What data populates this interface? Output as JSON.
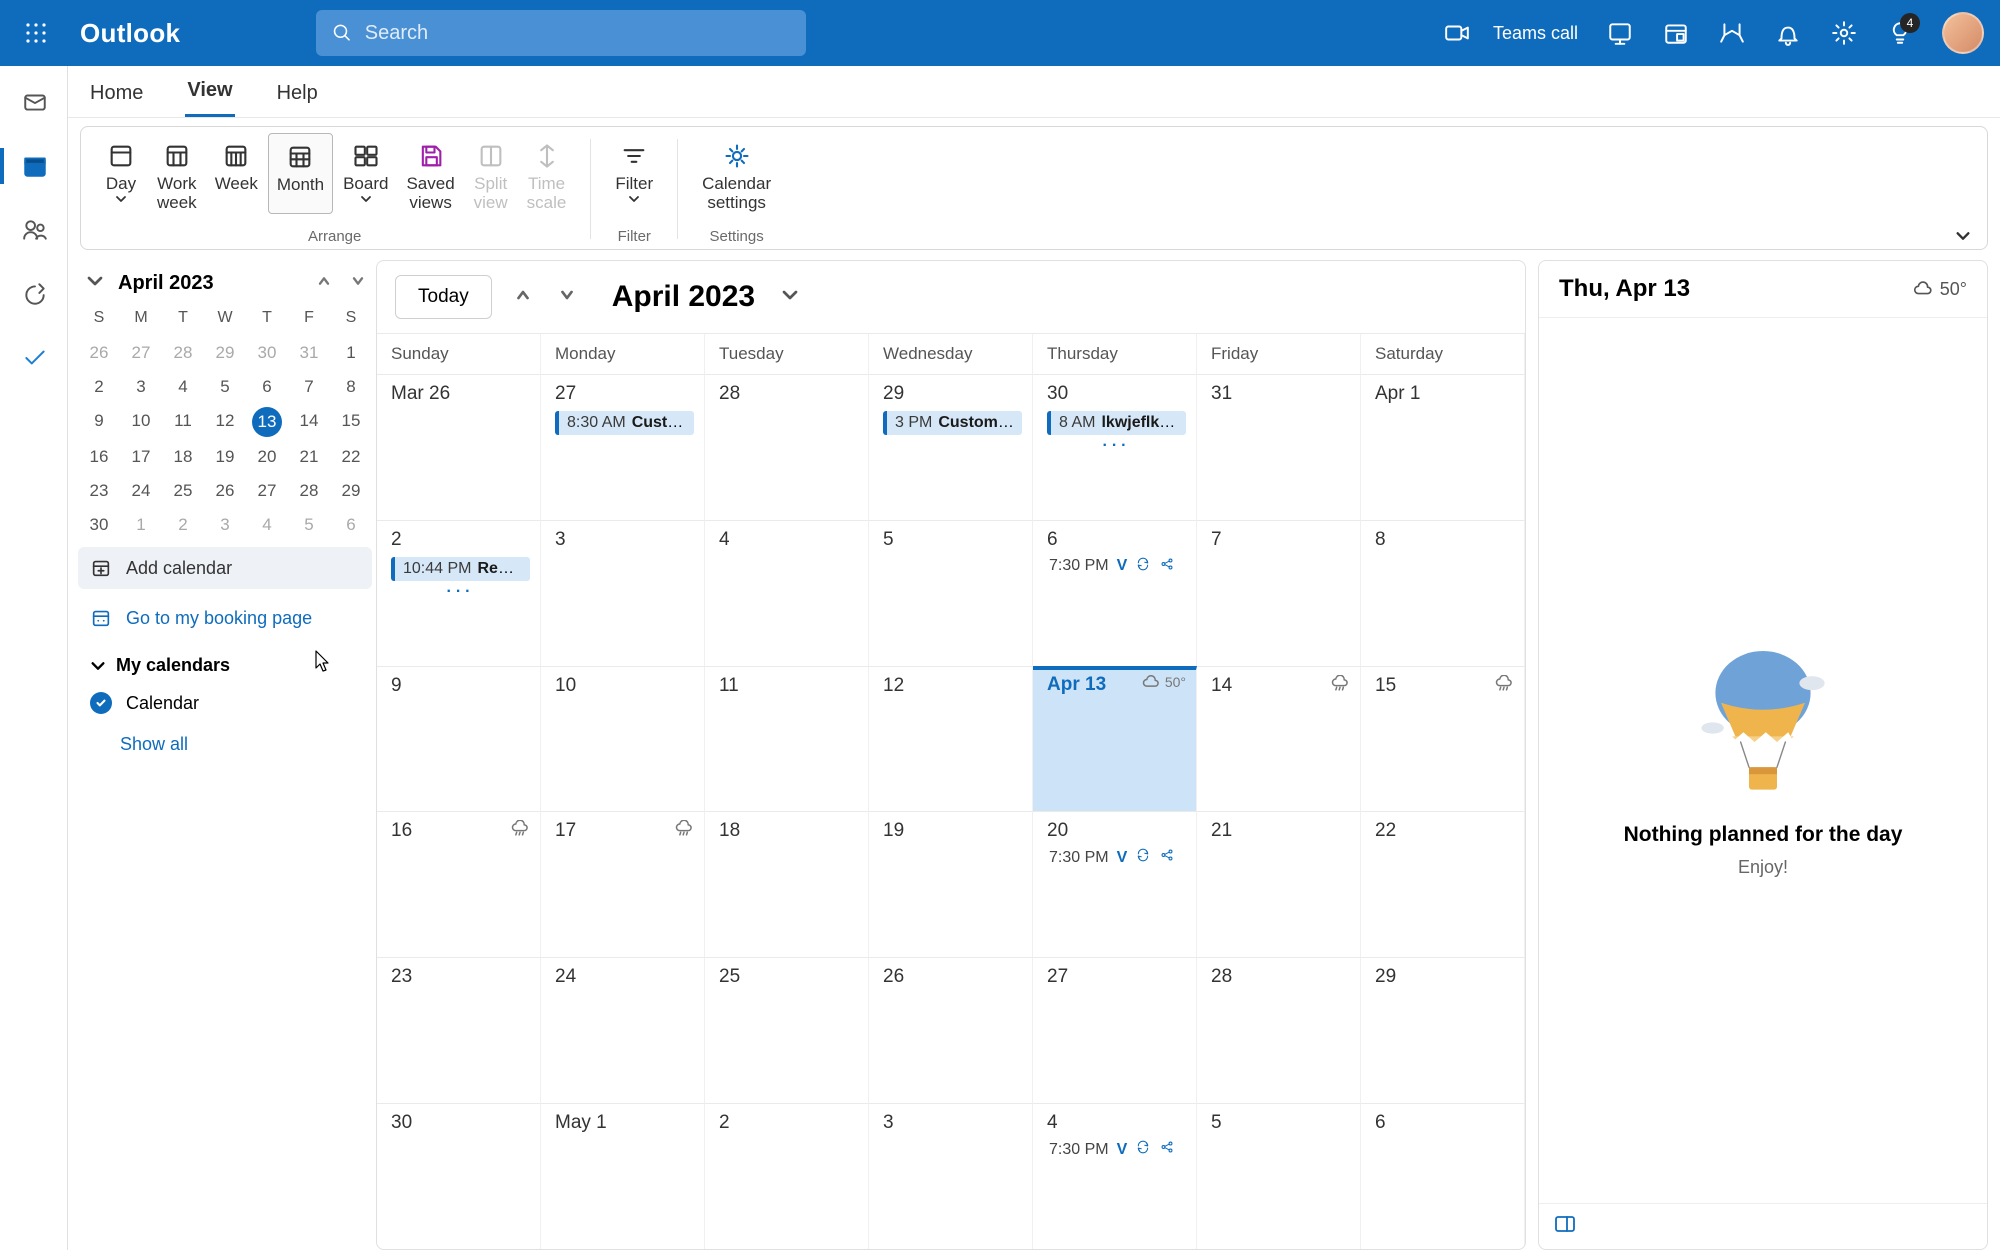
{
  "topbar": {
    "brand": "Outlook",
    "search_placeholder": "Search",
    "teams_label": "Teams call",
    "tips_badge": "4"
  },
  "tabs": {
    "home": "Home",
    "view": "View",
    "help": "Help"
  },
  "ribbon": {
    "day": "Day",
    "workweek": "Work\nweek",
    "week": "Week",
    "month": "Month",
    "board": "Board",
    "saved": "Saved\nviews",
    "split": "Split\nview",
    "timescale": "Time\nscale",
    "filter": "Filter",
    "calsettings": "Calendar\nsettings",
    "group_arrange": "Arrange",
    "group_filter": "Filter",
    "group_settings": "Settings"
  },
  "mini": {
    "title": "April 2023",
    "dow": [
      "S",
      "M",
      "T",
      "W",
      "T",
      "F",
      "S"
    ],
    "cells": [
      {
        "n": "26",
        "o": true
      },
      {
        "n": "27",
        "o": true
      },
      {
        "n": "28",
        "o": true
      },
      {
        "n": "29",
        "o": true
      },
      {
        "n": "30",
        "o": true
      },
      {
        "n": "31",
        "o": true
      },
      {
        "n": "1"
      },
      {
        "n": "2"
      },
      {
        "n": "3"
      },
      {
        "n": "4"
      },
      {
        "n": "5"
      },
      {
        "n": "6"
      },
      {
        "n": "7"
      },
      {
        "n": "8"
      },
      {
        "n": "9"
      },
      {
        "n": "10"
      },
      {
        "n": "11"
      },
      {
        "n": "12"
      },
      {
        "n": "13",
        "today": true
      },
      {
        "n": "14"
      },
      {
        "n": "15"
      },
      {
        "n": "16"
      },
      {
        "n": "17"
      },
      {
        "n": "18"
      },
      {
        "n": "19"
      },
      {
        "n": "20"
      },
      {
        "n": "21"
      },
      {
        "n": "22"
      },
      {
        "n": "23"
      },
      {
        "n": "24"
      },
      {
        "n": "25"
      },
      {
        "n": "26"
      },
      {
        "n": "27"
      },
      {
        "n": "28"
      },
      {
        "n": "29"
      },
      {
        "n": "30"
      },
      {
        "n": "1",
        "o": true
      },
      {
        "n": "2",
        "o": true
      },
      {
        "n": "3",
        "o": true
      },
      {
        "n": "4",
        "o": true
      },
      {
        "n": "5",
        "o": true
      },
      {
        "n": "6",
        "o": true
      }
    ]
  },
  "side": {
    "add_cal": "Add calendar",
    "booking": "Go to my booking page",
    "mycals": "My calendars",
    "cal0": "Calendar",
    "showall": "Show all"
  },
  "calhead": {
    "today": "Today",
    "title": "April 2023"
  },
  "dow_full": [
    "Sunday",
    "Monday",
    "Tuesday",
    "Wednesday",
    "Thursday",
    "Friday",
    "Saturday"
  ],
  "grid": [
    [
      {
        "n": "Mar 26"
      },
      {
        "n": "27",
        "events": [
          {
            "time": "8:30 AM",
            "title": "Custom",
            "box": true
          }
        ]
      },
      {
        "n": "28"
      },
      {
        "n": "29",
        "events": [
          {
            "time": "3 PM",
            "title": "Custom ev",
            "box": true
          }
        ]
      },
      {
        "n": "30",
        "events": [
          {
            "time": "8 AM",
            "title": "lkwjeflkwe",
            "box": true
          }
        ],
        "more": true
      },
      {
        "n": "31"
      },
      {
        "n": "Apr 1"
      }
    ],
    [
      {
        "n": "2",
        "events": [
          {
            "time": "10:44 PM",
            "title": "Reserv",
            "box": true
          }
        ],
        "more": true
      },
      {
        "n": "3"
      },
      {
        "n": "4"
      },
      {
        "n": "5"
      },
      {
        "n": "6",
        "events": [
          {
            "time": "7:30 PM",
            "title": "V",
            "recur": true,
            "share": true
          }
        ]
      },
      {
        "n": "7"
      },
      {
        "n": "8"
      }
    ],
    [
      {
        "n": "9"
      },
      {
        "n": "10"
      },
      {
        "n": "11"
      },
      {
        "n": "12"
      },
      {
        "n": "Apr 13",
        "today": true,
        "weather": "50°"
      },
      {
        "n": "14",
        "weathericon": true
      },
      {
        "n": "15",
        "weathericon": true
      }
    ],
    [
      {
        "n": "16",
        "weathericon": true
      },
      {
        "n": "17",
        "weathericon": true
      },
      {
        "n": "18"
      },
      {
        "n": "19"
      },
      {
        "n": "20",
        "events": [
          {
            "time": "7:30 PM",
            "title": "V",
            "recur": true,
            "share": true
          }
        ]
      },
      {
        "n": "21"
      },
      {
        "n": "22"
      }
    ],
    [
      {
        "n": "23"
      },
      {
        "n": "24"
      },
      {
        "n": "25"
      },
      {
        "n": "26"
      },
      {
        "n": "27"
      },
      {
        "n": "28"
      },
      {
        "n": "29"
      }
    ],
    [
      {
        "n": "30"
      },
      {
        "n": "May 1"
      },
      {
        "n": "2"
      },
      {
        "n": "3"
      },
      {
        "n": "4",
        "events": [
          {
            "time": "7:30 PM",
            "title": "V",
            "recur": true,
            "share": true
          }
        ]
      },
      {
        "n": "5"
      },
      {
        "n": "6"
      }
    ]
  ],
  "agenda": {
    "date": "Thu, Apr 13",
    "temp": "50°",
    "empty_title": "Nothing planned for the day",
    "empty_sub": "Enjoy!"
  }
}
